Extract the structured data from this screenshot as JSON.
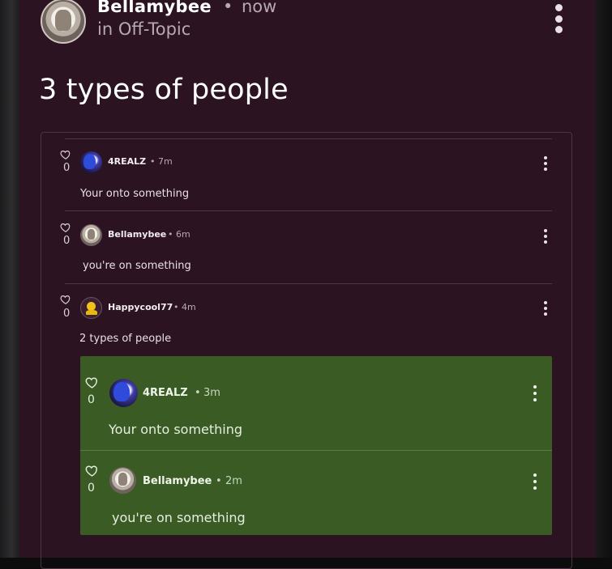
{
  "post": {
    "author": "Bellamybee",
    "separator": "•",
    "time": "now",
    "community": "in Off-Topic",
    "title": "3 types of people"
  },
  "comments": [
    {
      "author": "4REALZ",
      "separator": "•",
      "time": "7m",
      "likes": "0",
      "text": "Your onto something",
      "avatar": "anime-avatar"
    },
    {
      "author": "Bellamybee",
      "separator": "•",
      "time": "6m",
      "likes": "0",
      "text": "you're on something",
      "avatar": "cat-avatar"
    },
    {
      "author": "Happycool77",
      "separator": "•",
      "time": "4m",
      "likes": "0",
      "text": "2 types of people",
      "avatar": "smiley-avatar"
    }
  ],
  "highlighted": [
    {
      "author": "4REALZ",
      "separator": "•",
      "time": "3m",
      "likes": "0",
      "text": "Your onto something",
      "avatar": "anime-avatar"
    },
    {
      "author": "Bellamybee",
      "separator": "•",
      "time": "2m",
      "likes": "0",
      "text": "you're on something",
      "avatar": "cat-avatar"
    }
  ],
  "icons": {
    "like": "heart-icon",
    "menu": "more-vertical-icon"
  },
  "colors": {
    "panel": "#2b1322",
    "highlight": "#3a5c24",
    "text": "#ffffff",
    "muted": "#b7a9b2"
  }
}
